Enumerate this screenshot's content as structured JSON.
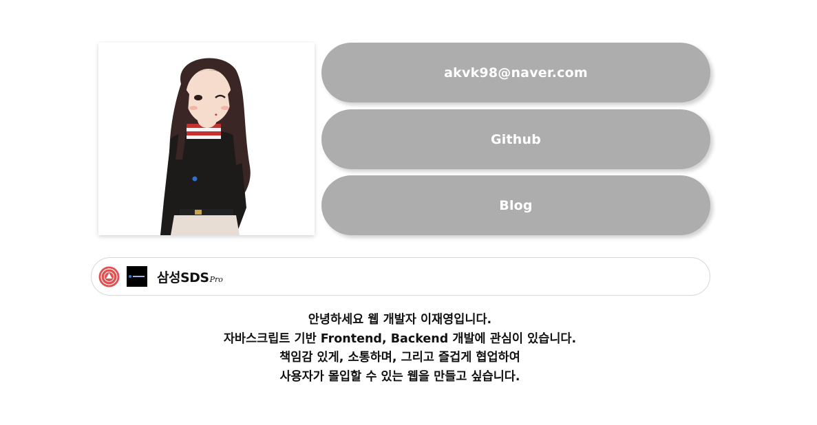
{
  "profile": {
    "photo_alt": "profile avatar"
  },
  "links": {
    "email_label": "akvk98@naver.com",
    "github_label": "Github",
    "blog_label": "Blog"
  },
  "experience": {
    "company_label": "삼성SDS",
    "company_suffix": "Pro",
    "seal_color": "#e05252",
    "dark_logo_color": "#000000"
  },
  "intro": {
    "lines": [
      "안녕하세요 웹 개발자 이재영입니다.",
      "자바스크립트 기반 Frontend, Backend 개발에 관심이 있습니다.",
      "책임감 있게, 소통하며, 그리고 즐겁게 협업하여",
      "사용자가 몰입할 수 있는 웹을 만들고 싶습니다."
    ]
  },
  "colors": {
    "button_bg": "#adadad",
    "button_text": "#ffffff"
  }
}
